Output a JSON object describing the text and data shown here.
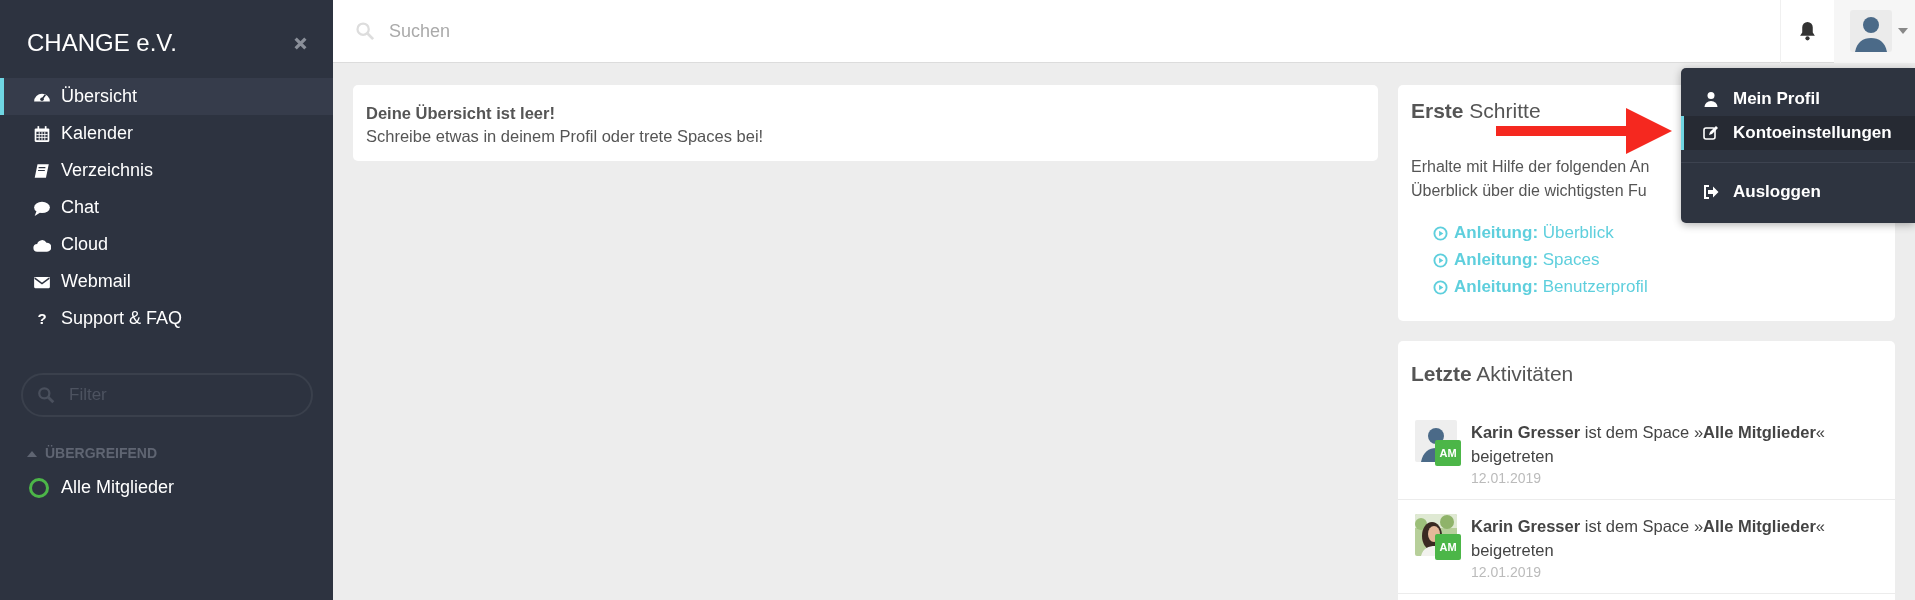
{
  "sidebar": {
    "title": "CHANGE e.V.",
    "nav": [
      {
        "label": "Übersicht",
        "selected": true
      },
      {
        "label": "Kalender",
        "selected": false
      },
      {
        "label": "Verzeichnis",
        "selected": false
      },
      {
        "label": "Chat",
        "selected": false
      },
      {
        "label": "Cloud",
        "selected": false
      },
      {
        "label": "Webmail",
        "selected": false
      },
      {
        "label": "Support & FAQ",
        "selected": false,
        "icon_text": "?"
      }
    ],
    "filter": {
      "placeholder": "Filter"
    },
    "group": {
      "title": "ÜBERGREIFEND",
      "expanded": true,
      "items": [
        {
          "label": "Alle Mitglieder"
        }
      ]
    }
  },
  "topbar": {
    "search": {
      "placeholder": "Suchen"
    }
  },
  "user_menu": {
    "items": [
      {
        "label": "Mein Profil",
        "selected": false
      },
      {
        "label": "Kontoeinstellungen",
        "selected": true
      },
      {
        "label": "Ausloggen",
        "selected": false
      }
    ]
  },
  "notice": {
    "title": "Deine Übersicht ist leer!",
    "text": "Schreibe etwas in deinem Profil oder trete Spaces bei!"
  },
  "first_steps": {
    "title": "**Erste** Schritte",
    "text_lines": [
      "Erhalte mit Hilfe der folgenden An",
      "Überblick über die wichtigsten Fu"
    ],
    "links": [
      {
        "label": "**Anleitung:** Überblick"
      },
      {
        "label": "**Anleitung:** Spaces"
      },
      {
        "label": "**Anleitung:** Benutzerprofil"
      }
    ]
  },
  "activities": {
    "title": "**Letzte** Aktivitäten",
    "items": [
      {
        "kind": "silhouette",
        "badge": "AM",
        "text": "**Karin Gresser** ist dem Space »**Alle Mitglieder**« beigetreten",
        "date": "12.01.2019"
      },
      {
        "kind": "picture",
        "badge": "AM",
        "text": "**Karin Gresser** ist dem Space »**Alle Mitglieder**« beigetreten",
        "date": "12.01.2019"
      }
    ]
  }
}
